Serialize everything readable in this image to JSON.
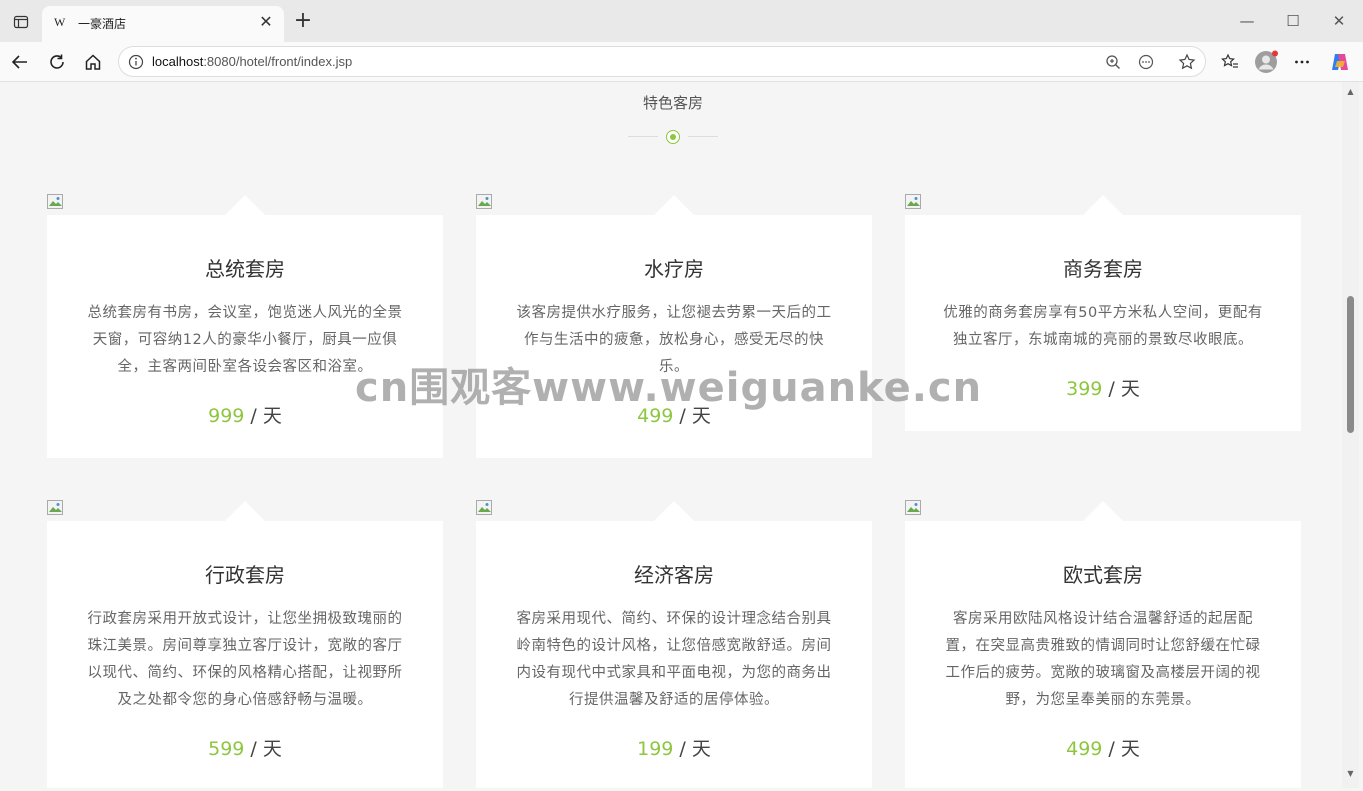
{
  "browser": {
    "tab_favicon": "W",
    "tab_title": "一豪酒店",
    "new_tab_label": "+",
    "url_host": "localhost",
    "url_rest": ":8080/hotel/front/index.jsp"
  },
  "page": {
    "section_title": "特色客房",
    "price_unit": " / 天",
    "rooms": [
      {
        "name": "总统套房",
        "description": "总统套房有书房，会议室，饱览迷人风光的全景天窗，可容纳12人的豪华小餐厅，厨具一应俱全，主客两间卧室各设会客区和浴室。",
        "price": "999"
      },
      {
        "name": "水疗房",
        "description": "该客房提供水疗服务，让您褪去劳累一天后的工作与生活中的疲惫，放松身心，感受无尽的快乐。",
        "price": "499"
      },
      {
        "name": "商务套房",
        "description": "优雅的商务套房享有50平方米私人空间，更配有独立客厅，东城南城的亮丽的景致尽收眼底。",
        "price": "399"
      },
      {
        "name": "行政套房",
        "description": "行政套房采用开放式设计，让您坐拥极致瑰丽的珠江美景。房间尊享独立客厅设计，宽敞的客厅以现代、简约、环保的风格精心搭配，让视野所及之处都令您的身心倍感舒畅与温暖。",
        "price": "599"
      },
      {
        "name": "经济客房",
        "description": "客房采用现代、简约、环保的设计理念结合别具岭南特色的设计风格，让您倍感宽敞舒适。房间内设有现代中式家具和平面电视，为您的商务出行提供温馨及舒适的居停体验。",
        "price": "199"
      },
      {
        "name": "欧式套房",
        "description": "客房采用欧陆风格设计结合温馨舒适的起居配置，在突显高贵雅致的情调同时让您舒缓在忙碌工作后的疲劳。宽敞的玻璃窗及高楼层开阔的视野，为您呈奉美丽的东莞景。",
        "price": "499"
      }
    ]
  },
  "watermark": "cn围观客www.weiguanke.cn",
  "colors": {
    "accent": "#8dc63f",
    "card_bg": "#ffffff",
    "page_bg": "#f5f5f5"
  }
}
